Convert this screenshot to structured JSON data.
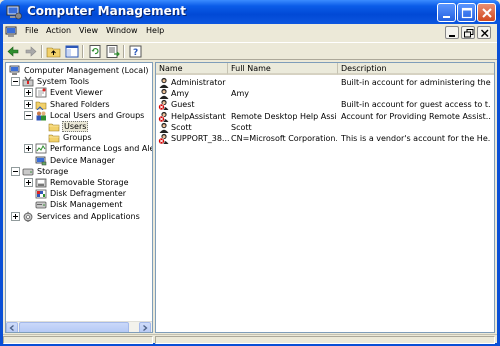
{
  "window": {
    "title": "Computer Management"
  },
  "menu": [
    "File",
    "Action",
    "View",
    "Window",
    "Help"
  ],
  "tree": [
    {
      "label": "Computer Management (Local)",
      "icon": "computer-icon",
      "level": 0,
      "expander": "none"
    },
    {
      "label": "System Tools",
      "icon": "tools-icon",
      "level": 1,
      "expander": "minus"
    },
    {
      "label": "Event Viewer",
      "icon": "event-viewer-icon",
      "level": 2,
      "expander": "plus"
    },
    {
      "label": "Shared Folders",
      "icon": "shared-folder-icon",
      "level": 2,
      "expander": "plus"
    },
    {
      "label": "Local Users and Groups",
      "icon": "users-groups-icon",
      "level": 2,
      "expander": "minus"
    },
    {
      "label": "Users",
      "icon": "folder-icon",
      "level": 3,
      "expander": "none",
      "selected": true
    },
    {
      "label": "Groups",
      "icon": "folder-icon",
      "level": 3,
      "expander": "none"
    },
    {
      "label": "Performance Logs and Alerts",
      "icon": "performance-icon",
      "level": 2,
      "expander": "plus"
    },
    {
      "label": "Device Manager",
      "icon": "device-manager-icon",
      "level": 2,
      "expander": "none"
    },
    {
      "label": "Storage",
      "icon": "storage-icon",
      "level": 1,
      "expander": "minus"
    },
    {
      "label": "Removable Storage",
      "icon": "removable-storage-icon",
      "level": 2,
      "expander": "plus"
    },
    {
      "label": "Disk Defragmenter",
      "icon": "defrag-icon",
      "level": 2,
      "expander": "none"
    },
    {
      "label": "Disk Management",
      "icon": "disk-icon",
      "level": 2,
      "expander": "none"
    },
    {
      "label": "Services and Applications",
      "icon": "services-icon",
      "level": 1,
      "expander": "plus"
    }
  ],
  "list": {
    "columns": [
      "Name",
      "Full Name",
      "Description"
    ],
    "rows": [
      {
        "name": "Administrator",
        "full_name": "",
        "description": "Built-in account for administering the...",
        "disabled": false
      },
      {
        "name": "Amy",
        "full_name": "Amy",
        "description": "",
        "disabled": false
      },
      {
        "name": "Guest",
        "full_name": "",
        "description": "Built-in account for guest access to t...",
        "disabled": true
      },
      {
        "name": "HelpAssistant",
        "full_name": "Remote Desktop Help Assi...",
        "description": "Account for Providing Remote Assist...",
        "disabled": true
      },
      {
        "name": "Scott",
        "full_name": "Scott",
        "description": "",
        "disabled": false
      },
      {
        "name": "SUPPORT_38...",
        "full_name": "CN=Microsoft Corporation...",
        "description": "This is a vendor's account for the He...",
        "disabled": true
      }
    ]
  },
  "colors": {
    "titlebar": "#0149d6",
    "selection": "#ece9d8",
    "disabled_badge": "#d20000"
  }
}
